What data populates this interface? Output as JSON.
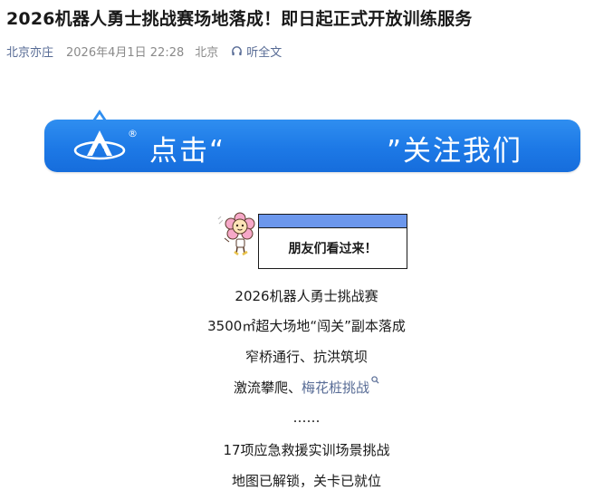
{
  "article": {
    "title": "2026机器人勇士挑战赛场地落成！即日起正式开放训练服务",
    "author": "北京亦庄",
    "date": "2026年4月1日 22:28",
    "location": "北京",
    "listen_label": "听全文"
  },
  "banner": {
    "reg_mark": "®",
    "prefix": "点击“",
    "suffix": "”关注我们"
  },
  "callout": {
    "text": "朋友们看过来！"
  },
  "body_lines": {
    "l1": "2026机器人勇士挑战赛",
    "l2": "3500㎡超大场地“闯关”副本落成",
    "l3": "窄桥通行、抗洪筑坝",
    "l4_prefix": "激流攀爬、",
    "l4_link": "梅花桩挑战",
    "l5": "……",
    "l6": "17项应急救援实训场景挑战",
    "l7": "地图已解锁，关卡已就位"
  },
  "colors": {
    "banner_blue": "#1d79e6",
    "link": "#576b95",
    "meta_gray": "#8a8a8a"
  },
  "icons": [
    "headphones-icon",
    "brand-logo-icon",
    "search-icon",
    "mascot-flower-icon"
  ]
}
